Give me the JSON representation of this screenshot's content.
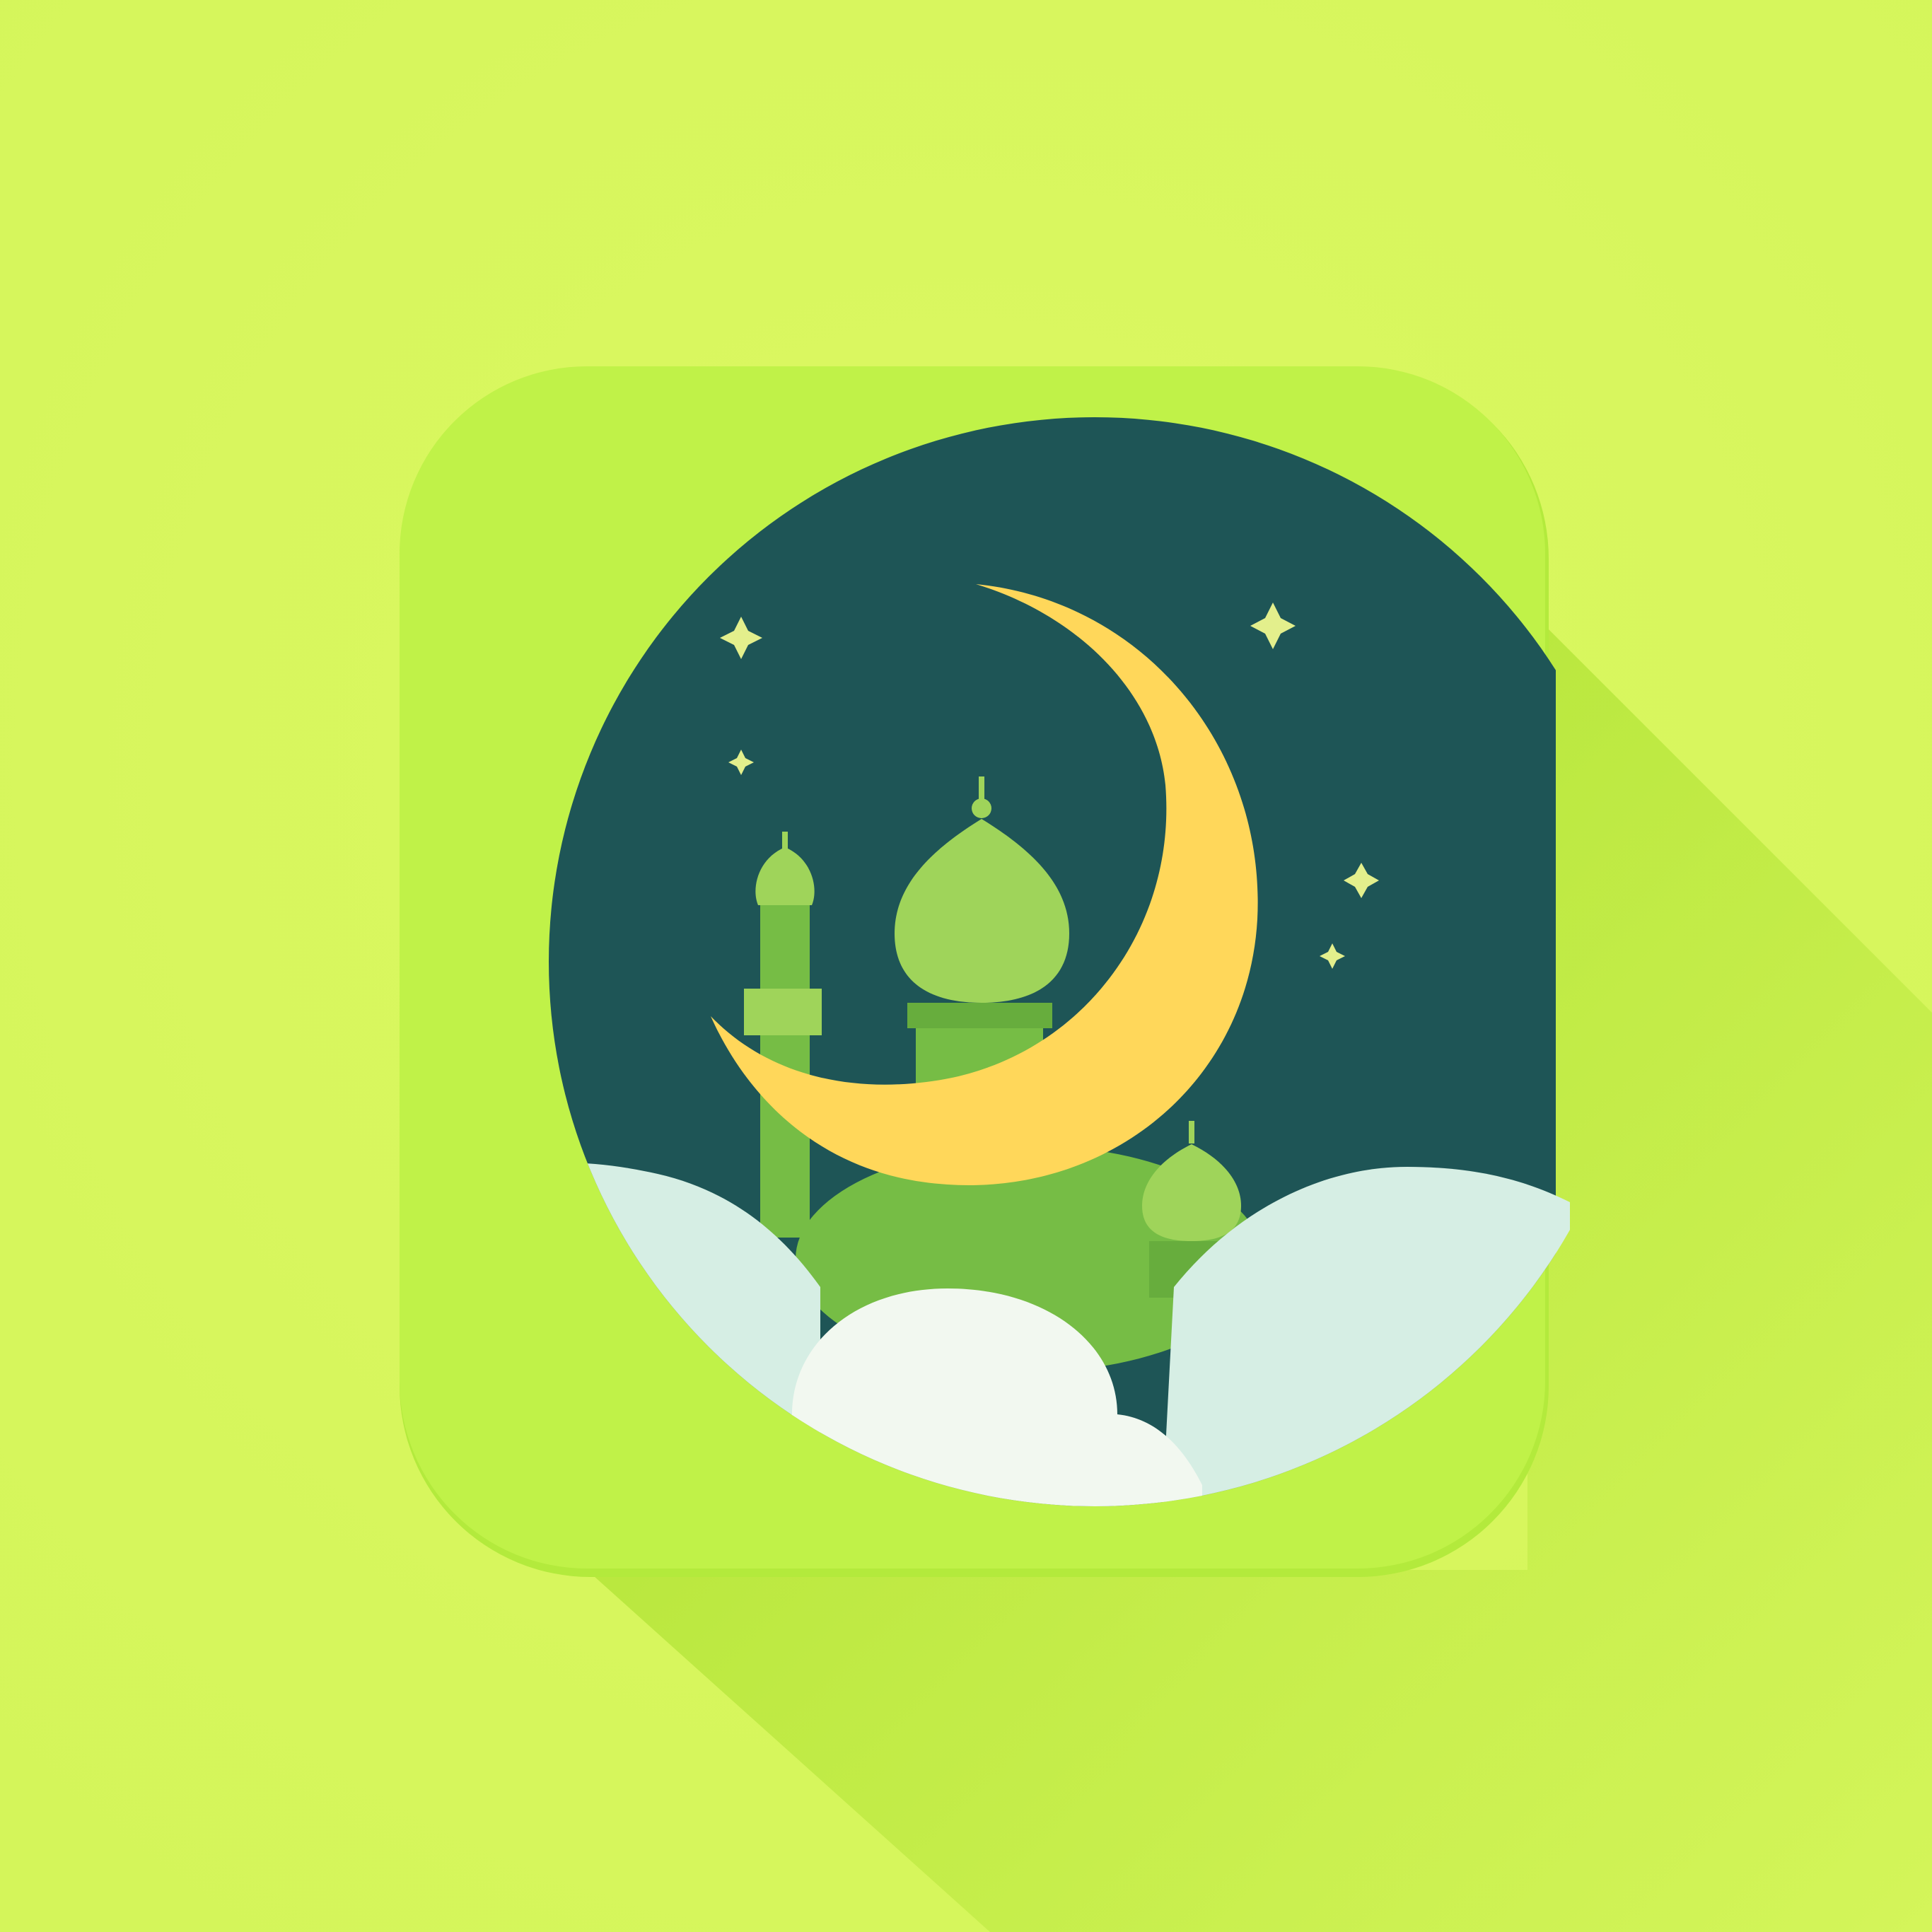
{
  "app_icon": {
    "name": "crescent-moon-mosque-app-icon",
    "stars": 5
  },
  "colors": {
    "background": "#d4f55a",
    "background_center": "#dcf862",
    "long_shadow": "#a6de2a",
    "tile": "#c0f248",
    "tile_edge": "#b3ea3c",
    "night_sky": "#1e5556",
    "night_sky_deep": "#184a4c",
    "crescent": "#ffd75a",
    "star": "#e3ef8c",
    "minaret_light": "#9fd45a",
    "mosque_green": "#76bd45",
    "mosque_dark": "#67ad3d",
    "cloud_back": "#d6eee4",
    "cloud_front": "#f2f8f0"
  }
}
